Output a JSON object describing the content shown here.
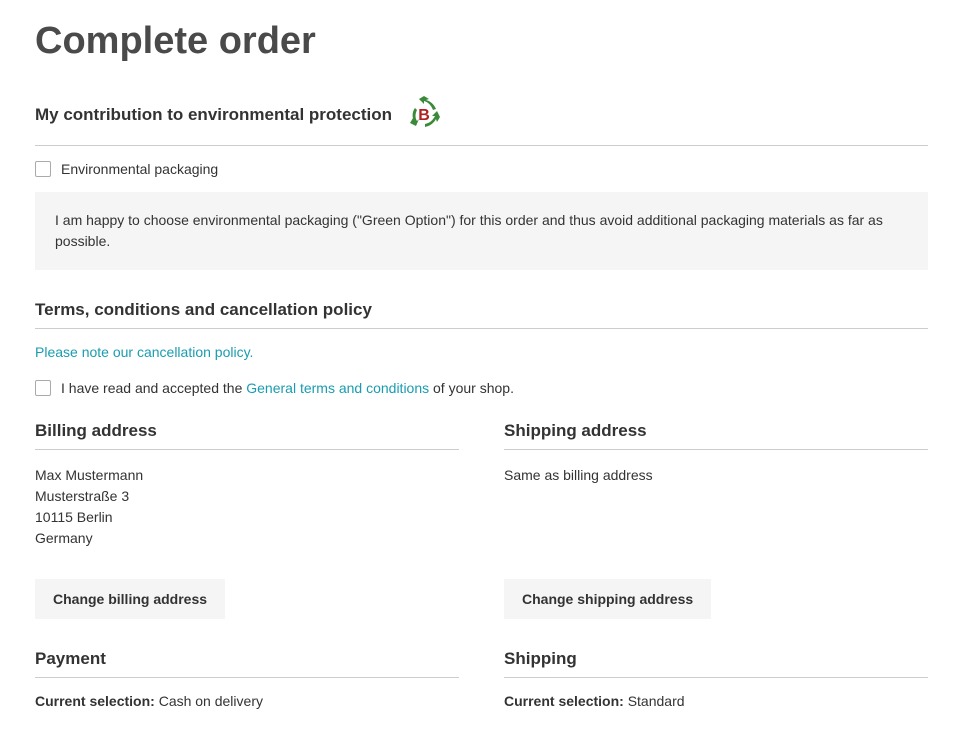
{
  "page_title": "Complete order",
  "env_section": {
    "heading": "My contribution to environmental protection",
    "checkbox_label": "Environmental packaging",
    "info_text": "I am happy to choose environmental packaging (\"Green Option\") for this order and thus avoid additional packaging materials as far as possible."
  },
  "terms_section": {
    "heading": "Terms, conditions and cancellation policy",
    "cancellation_link": "Please note our cancellation policy.",
    "accept_prefix": "I have read and accepted the ",
    "terms_link": "General terms and conditions",
    "accept_suffix": " of your shop."
  },
  "billing": {
    "heading": "Billing address",
    "name": "Max Mustermann",
    "street": "Musterstraße 3",
    "city": "10115 Berlin",
    "country": "Germany",
    "button": "Change billing address"
  },
  "shipping_addr": {
    "heading": "Shipping address",
    "text": "Same as billing address",
    "button": "Change shipping address"
  },
  "payment": {
    "heading": "Payment",
    "label": "Current selection:",
    "value": " Cash on delivery"
  },
  "shipping": {
    "heading": "Shipping",
    "label": "Current selection:",
    "value": " Standard"
  }
}
